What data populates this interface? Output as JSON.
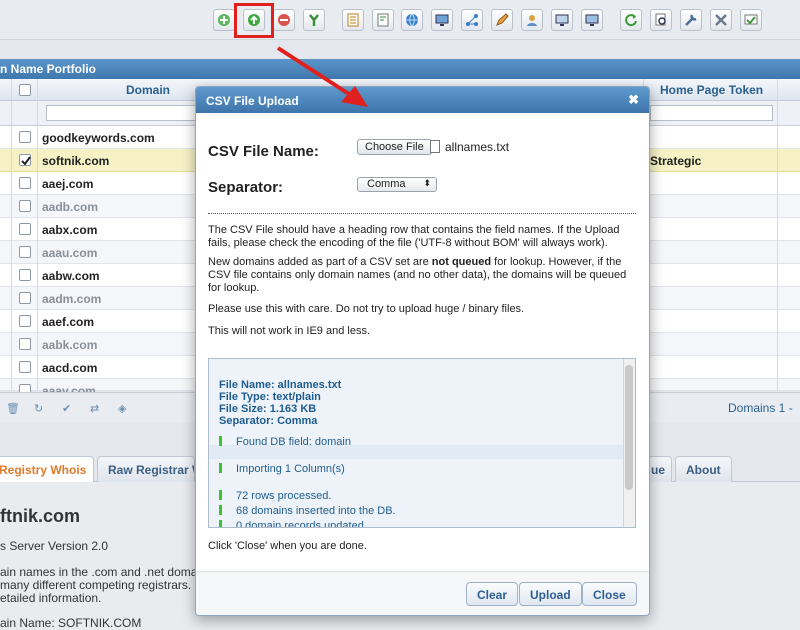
{
  "panel": {
    "title": "n Name Portfolio"
  },
  "grid": {
    "columns": {
      "domain": "Domain",
      "token": "Home Page Token"
    },
    "rows": [
      {
        "domain": "goodkeywords.com",
        "dim": false,
        "checked": false,
        "token": ""
      },
      {
        "domain": "softnik.com",
        "dim": false,
        "checked": true,
        "token": "Strategic"
      },
      {
        "domain": "aaej.com",
        "dim": false,
        "checked": false,
        "token": ""
      },
      {
        "domain": "aadb.com",
        "dim": true,
        "checked": false,
        "token": ""
      },
      {
        "domain": "aabx.com",
        "dim": false,
        "checked": false,
        "token": ""
      },
      {
        "domain": "aaau.com",
        "dim": true,
        "checked": false,
        "token": ""
      },
      {
        "domain": "aabw.com",
        "dim": false,
        "checked": false,
        "token": ""
      },
      {
        "domain": "aadm.com",
        "dim": true,
        "checked": false,
        "token": ""
      },
      {
        "domain": "aaef.com",
        "dim": false,
        "checked": false,
        "token": ""
      },
      {
        "domain": "aabk.com",
        "dim": true,
        "checked": false,
        "token": ""
      },
      {
        "domain": "aacd.com",
        "dim": false,
        "checked": false,
        "token": ""
      },
      {
        "domain": "aaav.com",
        "dim": true,
        "checked": false,
        "token": ""
      }
    ],
    "pager": "Domains 1 -"
  },
  "tabs": {
    "registry": "Registry Whois",
    "raw": "Raw Registrar W",
    "que": "ue",
    "about": "About"
  },
  "lower": {
    "heading": "ftnik.com",
    "line1": "s Server Version 2.0",
    "line2": "ain names in the .com and .net doma",
    "line3": "many different competing registrars.",
    "line4": "etailed information.",
    "line5": "ain Name: SOFTNIK.COM"
  },
  "dialog": {
    "title": "CSV File Upload",
    "close_glyph": "✖",
    "csv_label": "CSV File Name:",
    "choose_button": "Choose File",
    "file_name": "allnames.txt",
    "separator_label": "Separator:",
    "separator_value": "Comma",
    "para1": "The CSV File should have a heading row that contains the field names. If the Upload fails, please check the encoding of the file ('UTF-8 without BOM' will always work).",
    "para2_a": "New domains added as part of a CSV set are ",
    "para2_b": "not queued",
    "para2_c": " for lookup. However, if the CSV file contains only domain names (and no other data), the domains will be queued for lookup.",
    "para3": "Please use this with care. Do not try to upload huge / binary files.",
    "para4": "This will not work in IE9 and less.",
    "log": {
      "file_name": "File Name: allnames.txt",
      "file_type": "File Type: text/plain",
      "file_size": "File Size: 1.163 KB",
      "separator": "Separator: Comma",
      "entry1": "Found DB field: domain",
      "entry2": "Importing 1 Column(s)",
      "entry3": "72 rows processed.",
      "entry4": "68 domains inserted into the DB.",
      "entry5": "0 domain records updated."
    },
    "done_text": "Click 'Close' when you are done.",
    "buttons": {
      "clear": "Clear",
      "upload": "Upload",
      "close": "Close"
    }
  },
  "colors": {
    "accent": "#3d75ab",
    "highlight": "#e0201c",
    "selected_row": "#f7f2c6",
    "log_bar": "#3bc62f"
  },
  "icons": [
    "add-icon",
    "upload-icon",
    "remove-icon",
    "tools-icon",
    "report-icon",
    "note-icon",
    "globe-icon",
    "monitor-icon",
    "share-icon",
    "pencil-icon",
    "user-icon",
    "screen-icon",
    "screen2-icon",
    "refresh-icon",
    "search-doc-icon",
    "wrench-icon",
    "settings-icon",
    "check-icon"
  ]
}
